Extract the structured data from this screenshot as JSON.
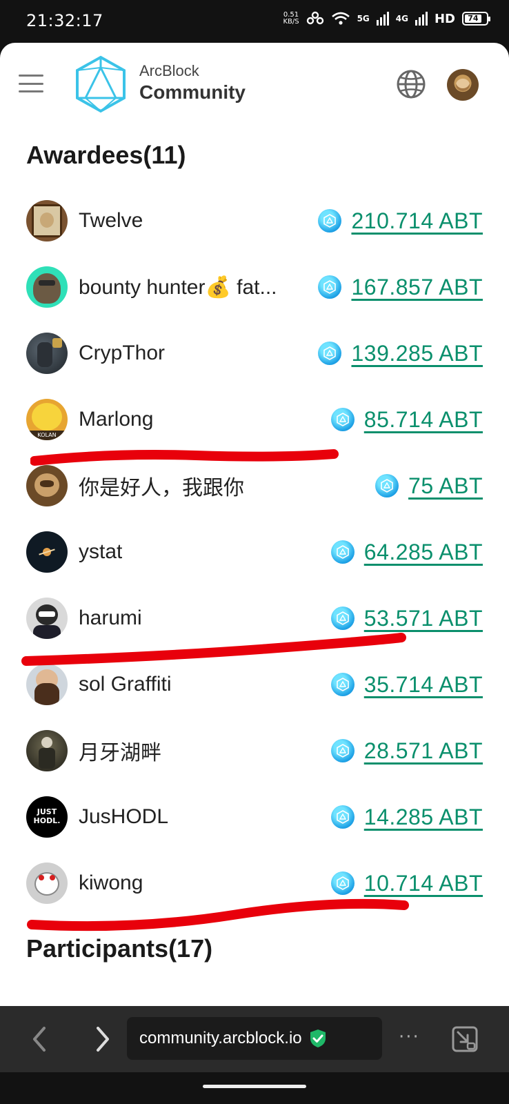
{
  "status_bar": {
    "time": "21:32:17",
    "net_speed": "0.51",
    "net_unit": "KB/S",
    "sig1": "5G",
    "sig2": "4G",
    "hd": "HD",
    "battery": "74"
  },
  "header": {
    "brand_top": "ArcBlock",
    "brand_bottom": "Community",
    "menu_icon": "hamburger-menu-icon",
    "language_icon": "globe-icon"
  },
  "awardees": {
    "title": "Awardees(11)",
    "rows": [
      {
        "name": "Twelve",
        "amount": "210.714 ABT"
      },
      {
        "name": "bounty hunter💰 fat...",
        "amount": "167.857 ABT"
      },
      {
        "name": "CrypThor",
        "amount": "139.285 ABT"
      },
      {
        "name": "Marlong",
        "amount": "85.714 ABT"
      },
      {
        "name": "你是好人，我跟你",
        "amount": "75 ABT"
      },
      {
        "name": "ystat",
        "amount": "64.285 ABT"
      },
      {
        "name": "harumi",
        "amount": "53.571 ABT"
      },
      {
        "name": "sol Graffiti",
        "amount": "35.714 ABT"
      },
      {
        "name": "月牙湖畔",
        "amount": "28.571 ABT"
      },
      {
        "name": "JusHODL",
        "amount": "14.285 ABT"
      },
      {
        "name": "kiwong",
        "amount": "10.714 ABT"
      }
    ]
  },
  "participants": {
    "title": "Participants(17)"
  },
  "avatar_labels": {
    "marlong": "KOLAN",
    "jushodl": "JUST HODL."
  },
  "browser": {
    "url": "community.arcblock.io",
    "more": "···"
  },
  "colors": {
    "amount": "#0a8f6c",
    "annotation": "#e8000b"
  }
}
